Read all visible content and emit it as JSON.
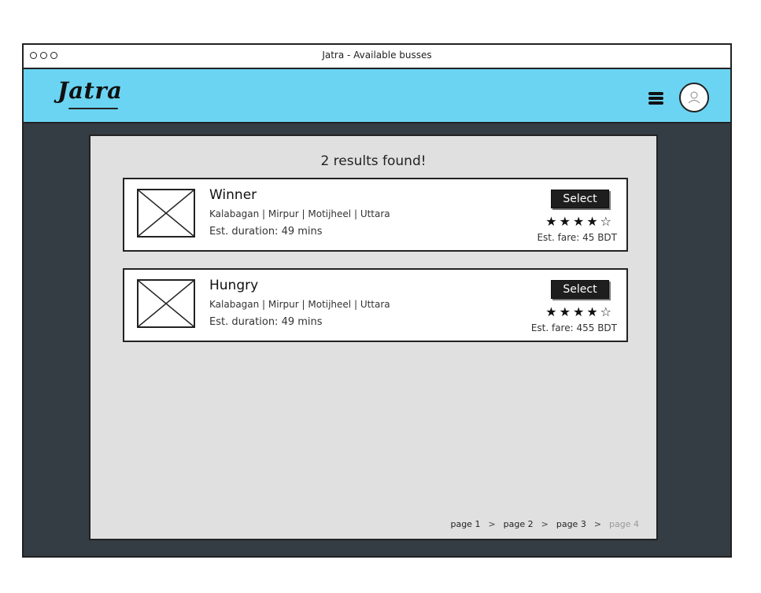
{
  "window": {
    "title": "Jatra - Available busses"
  },
  "header": {
    "logo": "Jatra",
    "menu_icon": "hamburger-menu-icon",
    "avatar_icon": "user-avatar-icon",
    "bg_color": "#6ad4f2"
  },
  "main": {
    "results_text": "2 results found!",
    "buses": [
      {
        "name": "Winner",
        "route": "Kalabagan | Mirpur | Motijheel | Uttara",
        "duration": "Est. duration: 49 mins",
        "select_label": "Select",
        "rating": 4,
        "rating_max": 5,
        "fare": "Est. fare: 45 BDT"
      },
      {
        "name": "Hungry",
        "route": "Kalabagan | Mirpur | Motijheel | Uttara",
        "duration": "Est. duration: 49 mins",
        "select_label": "Select",
        "rating": 4,
        "rating_max": 5,
        "fare": "Est. fare: 455 BDT"
      }
    ]
  },
  "pagination": {
    "pages": [
      "page 1",
      "page 2",
      "page 3",
      "page 4"
    ],
    "separator": ">",
    "current_index": 3
  },
  "colors": {
    "dark_bg": "#343c44",
    "content_bg": "#e0e0e0",
    "button_bg": "#1e1e1e"
  }
}
